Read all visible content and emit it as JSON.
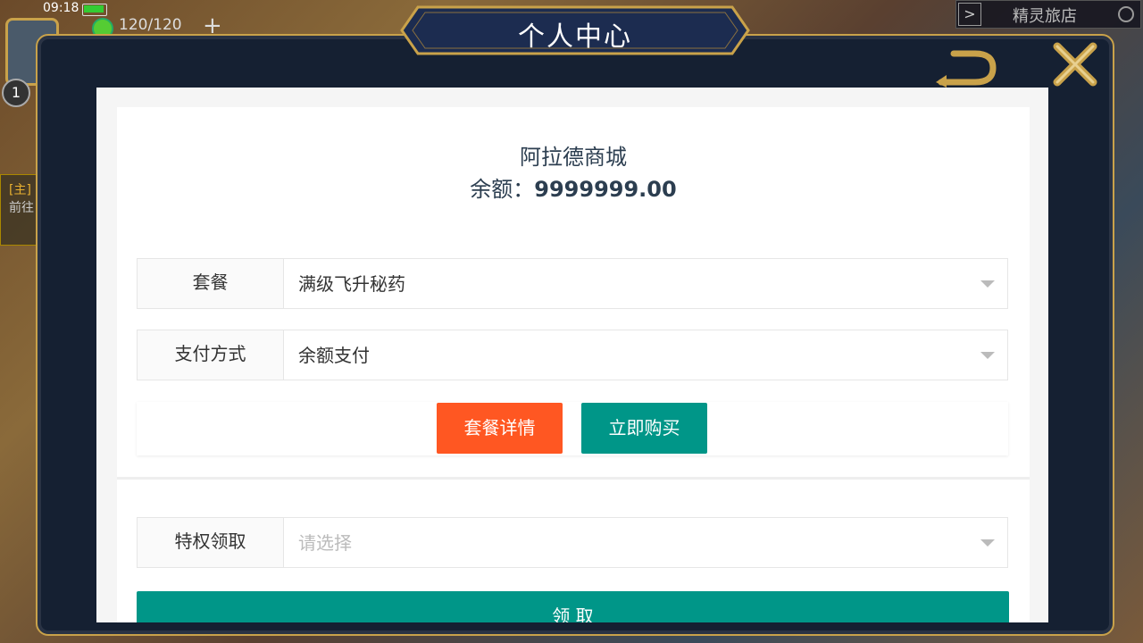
{
  "hud": {
    "time": "09:18",
    "energy": "120/120",
    "plus": "+",
    "level": "1",
    "quest_tag": "[主]",
    "quest_go": "前往",
    "shop_label": "精灵旅店",
    "shop_arrow": ">"
  },
  "dialog": {
    "title": "个人中心",
    "frame_color": "#c9a24a",
    "background_color": "#152032"
  },
  "store": {
    "name": "阿拉德商城",
    "balance_label": "余额：",
    "balance_value": "9999999.00"
  },
  "form": {
    "package_label": "套餐",
    "package_value": "满级飞升秘药",
    "payment_label": "支付方式",
    "payment_value": "余额支付",
    "detail_button": "套餐详情",
    "buy_button": "立即购买",
    "privilege_label": "特权领取",
    "privilege_placeholder": "请选择",
    "claim_button": "领 取"
  },
  "colors": {
    "detail_button": "#ff5722",
    "buy_button": "#009688",
    "claim_button": "#009688"
  },
  "icons": {
    "back": "back-arrow-icon",
    "close": "close-icon",
    "dropdown": "chevron-down-icon"
  }
}
